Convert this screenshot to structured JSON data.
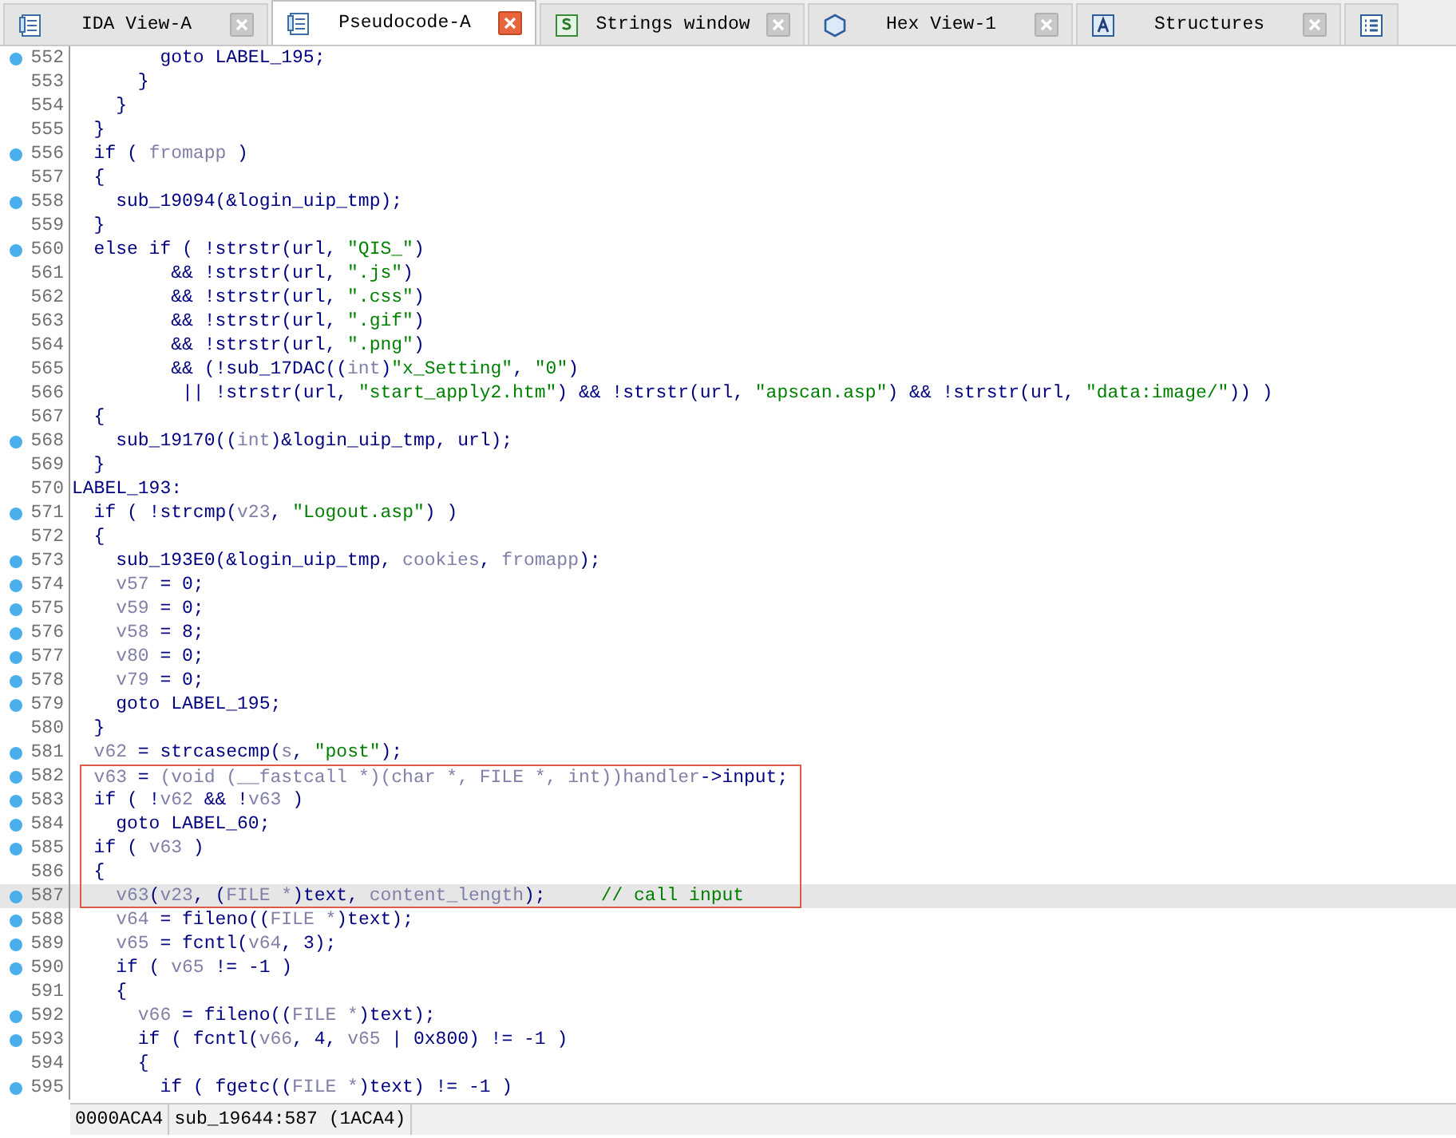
{
  "tabs": [
    {
      "label": "IDA View-A",
      "selected": false
    },
    {
      "label": "Pseudocode-A",
      "selected": true
    },
    {
      "label": "Strings window",
      "selected": false
    },
    {
      "label": "Hex View-1",
      "selected": false
    },
    {
      "label": "Structures",
      "selected": false
    },
    {
      "selected": false
    }
  ],
  "lines": [
    {
      "number": "552",
      "breakpoint": true,
      "current": false,
      "boxed": false,
      "code": [
        {
          "kind": "code",
          "text": "        goto LABEL_195;"
        }
      ]
    },
    {
      "number": "553",
      "breakpoint": false,
      "current": false,
      "boxed": false,
      "code": [
        {
          "kind": "code",
          "text": "      }"
        }
      ]
    },
    {
      "number": "554",
      "breakpoint": false,
      "current": false,
      "boxed": false,
      "code": [
        {
          "kind": "code",
          "text": "    }"
        }
      ]
    },
    {
      "number": "555",
      "breakpoint": false,
      "current": false,
      "boxed": false,
      "code": [
        {
          "kind": "code",
          "text": "  }"
        }
      ]
    },
    {
      "number": "556",
      "breakpoint": true,
      "current": false,
      "boxed": false,
      "code": [
        {
          "kind": "code",
          "text": "  if ( "
        },
        {
          "kind": "var",
          "text": "fromapp"
        },
        {
          "kind": "code",
          "text": " )"
        }
      ]
    },
    {
      "number": "557",
      "breakpoint": false,
      "current": false,
      "boxed": false,
      "code": [
        {
          "kind": "code",
          "text": "  {"
        }
      ]
    },
    {
      "number": "558",
      "breakpoint": true,
      "current": false,
      "boxed": false,
      "code": [
        {
          "kind": "code",
          "text": "    sub_19094(&login_uip_tmp);"
        }
      ]
    },
    {
      "number": "559",
      "breakpoint": false,
      "current": false,
      "boxed": false,
      "code": [
        {
          "kind": "code",
          "text": "  }"
        }
      ]
    },
    {
      "number": "560",
      "breakpoint": true,
      "current": false,
      "boxed": false,
      "code": [
        {
          "kind": "code",
          "text": "  else if ( !strstr(url, "
        },
        {
          "kind": "str",
          "text": "\"QIS_\""
        },
        {
          "kind": "code",
          "text": ")"
        }
      ]
    },
    {
      "number": "561",
      "breakpoint": false,
      "current": false,
      "boxed": false,
      "code": [
        {
          "kind": "code",
          "text": "         && !strstr(url, "
        },
        {
          "kind": "str",
          "text": "\".js\""
        },
        {
          "kind": "code",
          "text": ")"
        }
      ]
    },
    {
      "number": "562",
      "breakpoint": false,
      "current": false,
      "boxed": false,
      "code": [
        {
          "kind": "code",
          "text": "         && !strstr(url, "
        },
        {
          "kind": "str",
          "text": "\".css\""
        },
        {
          "kind": "code",
          "text": ")"
        }
      ]
    },
    {
      "number": "563",
      "breakpoint": false,
      "current": false,
      "boxed": false,
      "code": [
        {
          "kind": "code",
          "text": "         && !strstr(url, "
        },
        {
          "kind": "str",
          "text": "\".gif\""
        },
        {
          "kind": "code",
          "text": ")"
        }
      ]
    },
    {
      "number": "564",
      "breakpoint": false,
      "current": false,
      "boxed": false,
      "code": [
        {
          "kind": "code",
          "text": "         && !strstr(url, "
        },
        {
          "kind": "str",
          "text": "\".png\""
        },
        {
          "kind": "code",
          "text": ")"
        }
      ]
    },
    {
      "number": "565",
      "breakpoint": false,
      "current": false,
      "boxed": false,
      "code": [
        {
          "kind": "code",
          "text": "         && (!sub_17DAC(("
        },
        {
          "kind": "var",
          "text": "int"
        },
        {
          "kind": "code",
          "text": ")"
        },
        {
          "kind": "str",
          "text": "\"x_Setting\""
        },
        {
          "kind": "code",
          "text": ", "
        },
        {
          "kind": "str",
          "text": "\"0\""
        },
        {
          "kind": "code",
          "text": ")"
        }
      ]
    },
    {
      "number": "566",
      "breakpoint": false,
      "current": false,
      "boxed": false,
      "code": [
        {
          "kind": "code",
          "text": "          || !strstr(url, "
        },
        {
          "kind": "str",
          "text": "\"start_apply2.htm\""
        },
        {
          "kind": "code",
          "text": ") && !strstr(url, "
        },
        {
          "kind": "str",
          "text": "\"apscan.asp\""
        },
        {
          "kind": "code",
          "text": ") && !strstr(url, "
        },
        {
          "kind": "str",
          "text": "\"data:image/\""
        },
        {
          "kind": "code",
          "text": ")) )"
        }
      ]
    },
    {
      "number": "567",
      "breakpoint": false,
      "current": false,
      "boxed": false,
      "code": [
        {
          "kind": "code",
          "text": "  {"
        }
      ]
    },
    {
      "number": "568",
      "breakpoint": true,
      "current": false,
      "boxed": false,
      "code": [
        {
          "kind": "code",
          "text": "    sub_19170(("
        },
        {
          "kind": "var",
          "text": "int"
        },
        {
          "kind": "code",
          "text": ")&login_uip_tmp, url);"
        }
      ]
    },
    {
      "number": "569",
      "breakpoint": false,
      "current": false,
      "boxed": false,
      "code": [
        {
          "kind": "code",
          "text": "  }"
        }
      ]
    },
    {
      "number": "570",
      "breakpoint": false,
      "current": false,
      "boxed": false,
      "code": [
        {
          "kind": "code",
          "text": "LABEL_193:"
        }
      ]
    },
    {
      "number": "571",
      "breakpoint": true,
      "current": false,
      "boxed": false,
      "code": [
        {
          "kind": "code",
          "text": "  if ( !strcmp("
        },
        {
          "kind": "var",
          "text": "v23"
        },
        {
          "kind": "code",
          "text": ", "
        },
        {
          "kind": "str",
          "text": "\"Logout.asp\""
        },
        {
          "kind": "code",
          "text": ") )"
        }
      ]
    },
    {
      "number": "572",
      "breakpoint": false,
      "current": false,
      "boxed": false,
      "code": [
        {
          "kind": "code",
          "text": "  {"
        }
      ]
    },
    {
      "number": "573",
      "breakpoint": true,
      "current": false,
      "boxed": false,
      "code": [
        {
          "kind": "code",
          "text": "    sub_193E0(&login_uip_tmp, "
        },
        {
          "kind": "var",
          "text": "cookies"
        },
        {
          "kind": "code",
          "text": ", "
        },
        {
          "kind": "var",
          "text": "fromapp"
        },
        {
          "kind": "code",
          "text": ");"
        }
      ]
    },
    {
      "number": "574",
      "breakpoint": true,
      "current": false,
      "boxed": false,
      "code": [
        {
          "kind": "var",
          "text": "    v57"
        },
        {
          "kind": "code",
          "text": " = 0;"
        }
      ]
    },
    {
      "number": "575",
      "breakpoint": true,
      "current": false,
      "boxed": false,
      "code": [
        {
          "kind": "var",
          "text": "    v59"
        },
        {
          "kind": "code",
          "text": " = 0;"
        }
      ]
    },
    {
      "number": "576",
      "breakpoint": true,
      "current": false,
      "boxed": false,
      "code": [
        {
          "kind": "var",
          "text": "    v58"
        },
        {
          "kind": "code",
          "text": " = 8;"
        }
      ]
    },
    {
      "number": "577",
      "breakpoint": true,
      "current": false,
      "boxed": false,
      "code": [
        {
          "kind": "var",
          "text": "    v80"
        },
        {
          "kind": "code",
          "text": " = 0;"
        }
      ]
    },
    {
      "number": "578",
      "breakpoint": true,
      "current": false,
      "boxed": false,
      "code": [
        {
          "kind": "var",
          "text": "    v79"
        },
        {
          "kind": "code",
          "text": " = 0;"
        }
      ]
    },
    {
      "number": "579",
      "breakpoint": true,
      "current": false,
      "boxed": false,
      "code": [
        {
          "kind": "code",
          "text": "    goto LABEL_195;"
        }
      ]
    },
    {
      "number": "580",
      "breakpoint": false,
      "current": false,
      "boxed": false,
      "code": [
        {
          "kind": "code",
          "text": "  }"
        }
      ]
    },
    {
      "number": "581",
      "breakpoint": true,
      "current": false,
      "boxed": false,
      "code": [
        {
          "kind": "var",
          "text": "  v62"
        },
        {
          "kind": "code",
          "text": " = strcasecmp("
        },
        {
          "kind": "var",
          "text": "s"
        },
        {
          "kind": "code",
          "text": ", "
        },
        {
          "kind": "str",
          "text": "\"post\""
        },
        {
          "kind": "code",
          "text": ");"
        }
      ]
    },
    {
      "number": "582",
      "breakpoint": true,
      "current": false,
      "boxed": true,
      "code": [
        {
          "kind": "var",
          "text": "  v63"
        },
        {
          "kind": "code",
          "text": " = "
        },
        {
          "kind": "var",
          "text": "(void (__fastcall *)(char *, FILE *, int))handler"
        },
        {
          "kind": "code",
          "text": "->input;"
        }
      ]
    },
    {
      "number": "583",
      "breakpoint": true,
      "current": false,
      "boxed": true,
      "code": [
        {
          "kind": "code",
          "text": "  if ( !"
        },
        {
          "kind": "var",
          "text": "v62"
        },
        {
          "kind": "code",
          "text": " && !"
        },
        {
          "kind": "var",
          "text": "v63"
        },
        {
          "kind": "code",
          "text": " )"
        }
      ]
    },
    {
      "number": "584",
      "breakpoint": true,
      "current": false,
      "boxed": true,
      "code": [
        {
          "kind": "code",
          "text": "    goto LABEL_60;"
        }
      ]
    },
    {
      "number": "585",
      "breakpoint": true,
      "current": false,
      "boxed": true,
      "code": [
        {
          "kind": "code",
          "text": "  if ( "
        },
        {
          "kind": "var",
          "text": "v63"
        },
        {
          "kind": "code",
          "text": " )"
        }
      ]
    },
    {
      "number": "586",
      "breakpoint": false,
      "current": false,
      "boxed": true,
      "code": [
        {
          "kind": "code",
          "text": "  {"
        }
      ]
    },
    {
      "number": "587",
      "breakpoint": true,
      "current": true,
      "boxed": true,
      "code": [
        {
          "kind": "var",
          "text": "    v63"
        },
        {
          "kind": "code",
          "text": "("
        },
        {
          "kind": "var",
          "text": "v23"
        },
        {
          "kind": "code",
          "text": ", ("
        },
        {
          "kind": "var",
          "text": "FILE *"
        },
        {
          "kind": "code",
          "text": ")text, "
        },
        {
          "kind": "var",
          "text": "content_length"
        },
        {
          "kind": "code",
          "text": ");     "
        },
        {
          "kind": "comment",
          "text": "// call input"
        }
      ]
    },
    {
      "number": "588",
      "breakpoint": true,
      "current": false,
      "boxed": false,
      "code": [
        {
          "kind": "var",
          "text": "    v64"
        },
        {
          "kind": "code",
          "text": " = fileno(("
        },
        {
          "kind": "var",
          "text": "FILE *"
        },
        {
          "kind": "code",
          "text": ")text);"
        }
      ]
    },
    {
      "number": "589",
      "breakpoint": true,
      "current": false,
      "boxed": false,
      "code": [
        {
          "kind": "var",
          "text": "    v65"
        },
        {
          "kind": "code",
          "text": " = fcntl("
        },
        {
          "kind": "var",
          "text": "v64"
        },
        {
          "kind": "code",
          "text": ", 3);"
        }
      ]
    },
    {
      "number": "590",
      "breakpoint": true,
      "current": false,
      "boxed": false,
      "code": [
        {
          "kind": "code",
          "text": "    if ( "
        },
        {
          "kind": "var",
          "text": "v65"
        },
        {
          "kind": "code",
          "text": " != -1 )"
        }
      ]
    },
    {
      "number": "591",
      "breakpoint": false,
      "current": false,
      "boxed": false,
      "code": [
        {
          "kind": "code",
          "text": "    {"
        }
      ]
    },
    {
      "number": "592",
      "breakpoint": true,
      "current": false,
      "boxed": false,
      "code": [
        {
          "kind": "var",
          "text": "      v66"
        },
        {
          "kind": "code",
          "text": " = fileno(("
        },
        {
          "kind": "var",
          "text": "FILE *"
        },
        {
          "kind": "code",
          "text": ")text);"
        }
      ]
    },
    {
      "number": "593",
      "breakpoint": true,
      "current": false,
      "boxed": false,
      "code": [
        {
          "kind": "code",
          "text": "      if ( fcntl("
        },
        {
          "kind": "var",
          "text": "v66"
        },
        {
          "kind": "code",
          "text": ", 4, "
        },
        {
          "kind": "var",
          "text": "v65"
        },
        {
          "kind": "code",
          "text": " | 0x800) != -1 )"
        }
      ]
    },
    {
      "number": "594",
      "breakpoint": false,
      "current": false,
      "boxed": false,
      "code": [
        {
          "kind": "code",
          "text": "      {"
        }
      ]
    },
    {
      "number": "595",
      "breakpoint": true,
      "current": false,
      "boxed": false,
      "code": [
        {
          "kind": "code",
          "text": "        if ( fgetc(("
        },
        {
          "kind": "var",
          "text": "FILE *"
        },
        {
          "kind": "code",
          "text": ")text) != -1 )"
        }
      ]
    }
  ],
  "status_bar": {
    "address": "0000ACA4",
    "location": "sub_19644:587 (1ACA4)"
  }
}
